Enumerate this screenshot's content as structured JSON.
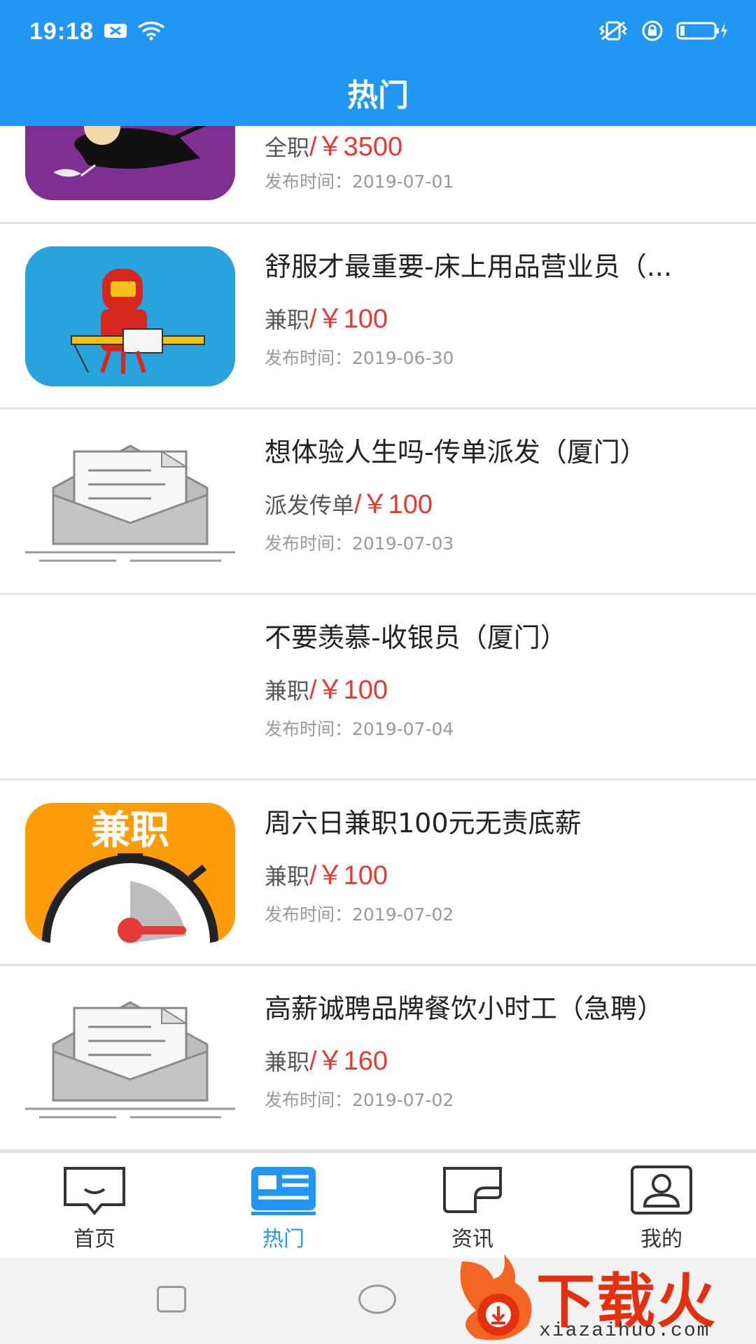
{
  "status_bar": {
    "time": "19:18"
  },
  "header": {
    "title": "热门"
  },
  "jobs": [
    {
      "title": "",
      "category": "全职",
      "salary": "/￥3500",
      "published": "发布时间：2019-07-01",
      "thumb": "ninja-cartoon"
    },
    {
      "title": "舒服才最重要-床上用品营业员（...",
      "category": "兼职",
      "salary": "/￥100",
      "published": "发布时间：2019-06-30",
      "thumb": "ironman-cartoon"
    },
    {
      "title": "想体验人生吗-传单派发（厦门）",
      "category": "派发传单",
      "salary": "/￥100",
      "published": "发布时间：2019-07-03",
      "thumb": "envelope-letter"
    },
    {
      "title": "不要羡慕-收银员（厦门）",
      "category": "兼职",
      "salary": "/￥100",
      "published": "发布时间：2019-07-04",
      "thumb": "none"
    },
    {
      "title": "周六日兼职100元无责底薪",
      "category": "兼职",
      "salary": "/￥100",
      "published": "发布时间：2019-07-02",
      "thumb": "parttime-stopwatch"
    },
    {
      "title": "高薪诚聘品牌餐饮小时工（急聘）",
      "category": "兼职",
      "salary": "/￥160",
      "published": "发布时间：2019-07-02",
      "thumb": "envelope-letter"
    }
  ],
  "thumb_text": {
    "parttime": "兼职"
  },
  "tabs": [
    {
      "label": "首页",
      "icon": "chat-smile-icon",
      "active": false
    },
    {
      "label": "热门",
      "icon": "news-card-icon",
      "active": true
    },
    {
      "label": "资讯",
      "icon": "info-card-icon",
      "active": false
    },
    {
      "label": "我的",
      "icon": "profile-icon",
      "active": false
    }
  ],
  "watermark": {
    "brand": "下载火",
    "domain": "xiazaihuo.com"
  },
  "colors": {
    "primary": "#2196F3",
    "price": "#e53935",
    "watermark": "#e3300e"
  }
}
